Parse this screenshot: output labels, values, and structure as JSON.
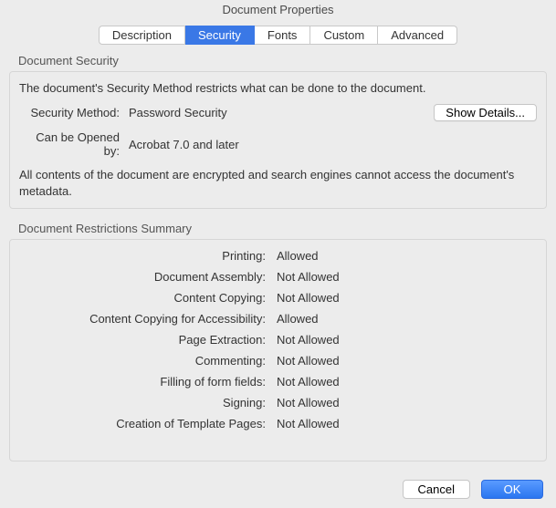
{
  "window": {
    "title": "Document Properties"
  },
  "tabs": {
    "description": "Description",
    "security": "Security",
    "fonts": "Fonts",
    "custom": "Custom",
    "advanced": "Advanced"
  },
  "security": {
    "section_title": "Document Security",
    "intro": "The document's Security Method restricts what can be done to the document.",
    "method_label": "Security Method:",
    "method_value": "Password Security",
    "show_details": "Show Details...",
    "opened_by_label": "Can be Opened by:",
    "opened_by_value": "Acrobat 7.0 and later",
    "encryption_note": "All contents of the document are encrypted and search engines cannot access the document's metadata."
  },
  "restrictions": {
    "section_title": "Document Restrictions Summary",
    "rows": [
      {
        "label": "Printing:",
        "value": "Allowed"
      },
      {
        "label": "Document Assembly:",
        "value": "Not Allowed"
      },
      {
        "label": "Content Copying:",
        "value": "Not Allowed"
      },
      {
        "label": "Content Copying for Accessibility:",
        "value": "Allowed"
      },
      {
        "label": "Page Extraction:",
        "value": "Not Allowed"
      },
      {
        "label": "Commenting:",
        "value": "Not Allowed"
      },
      {
        "label": "Filling of form fields:",
        "value": "Not Allowed"
      },
      {
        "label": "Signing:",
        "value": "Not Allowed"
      },
      {
        "label": "Creation of Template Pages:",
        "value": "Not Allowed"
      }
    ]
  },
  "buttons": {
    "cancel": "Cancel",
    "ok": "OK"
  }
}
